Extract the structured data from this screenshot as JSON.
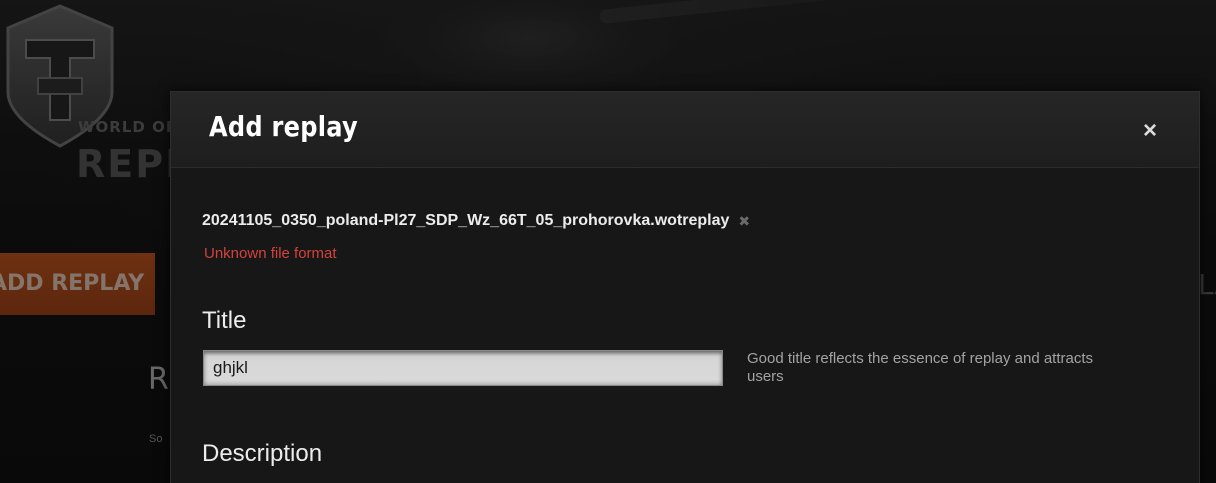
{
  "background": {
    "logo": {
      "line1": "WORLD OF",
      "line2": "REPL"
    },
    "nav_add_replay": "ADD REPLAY",
    "heading_fragment": "R",
    "sub_fragment": "So",
    "right_fragment": "LA"
  },
  "modal": {
    "title": "Add replay",
    "close_glyph": "×",
    "file": {
      "name": "20241105_0350_poland-Pl27_SDP_Wz_66T_05_prohorovka.wotreplay",
      "remove_glyph": "✖",
      "error": "Unknown file format"
    },
    "title_field": {
      "label": "Title",
      "value": "ghjkl",
      "hint": "Good title reflects the essence of replay and attracts users"
    },
    "description_field": {
      "label": "Description"
    }
  },
  "colors": {
    "accent_orange": "#c95a1f",
    "error_red": "#d3423b",
    "modal_bg": "#171717"
  }
}
